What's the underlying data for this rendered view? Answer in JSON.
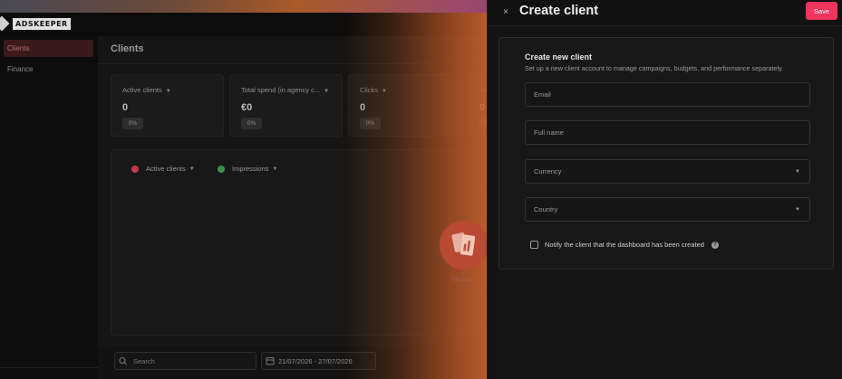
{
  "brand": {
    "logo_text": "ADSKEEPER"
  },
  "sidebar": {
    "items": [
      {
        "label": "Clients",
        "active": true
      },
      {
        "label": "Finance",
        "active": false
      }
    ]
  },
  "main": {
    "title": "Clients",
    "cards": [
      {
        "label": "Active clients",
        "value": "0",
        "change": "0%"
      },
      {
        "label": "Total spend (in agency c...",
        "value": "€0",
        "change": "0%"
      },
      {
        "label": "Clicks",
        "value": "0",
        "change": "0%"
      },
      {
        "label": "Im",
        "value": "0",
        "change": "0%"
      }
    ],
    "chart_legend": [
      {
        "label": "Active clients",
        "color": "#c0394a"
      },
      {
        "label": "Impressions",
        "color": "#3f8f4a"
      }
    ],
    "no_data_text": "No data",
    "search": {
      "placeholder": "Search"
    },
    "date_range": "21/07/2026 - 27/07/2026"
  },
  "drawer": {
    "title": "Create client",
    "save_label": "Save",
    "close_glyph": "×",
    "form": {
      "heading": "Create new client",
      "subtitle": "Set up a new client account to manage campaigns, budgets, and performance separately.",
      "email_placeholder": "Email",
      "fullname_placeholder": "Full name",
      "currency_label": "Currency",
      "country_label": "Country",
      "notify_label": "Notify the client that the dashboard has been created",
      "help_glyph": "?"
    }
  },
  "colors": {
    "accent": "#f0345e",
    "active_nav_bg": "#3a1a1c",
    "no_data_icon": "#b84a34"
  },
  "icons": {
    "close": "close-icon",
    "search": "search-icon",
    "calendar": "calendar-icon",
    "help": "help-icon",
    "chevron": "chevron-down-icon"
  }
}
